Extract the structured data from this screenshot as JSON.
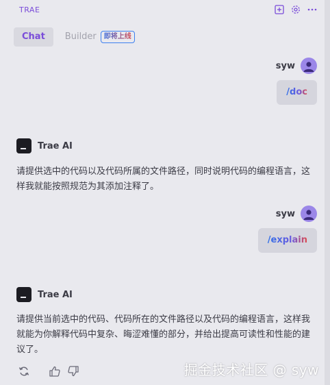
{
  "app": {
    "title": "TRAE"
  },
  "header_icons": [
    "add-square-icon",
    "gear-icon",
    "more-dots-icon"
  ],
  "tabs": [
    {
      "label": "Chat",
      "active": true
    },
    {
      "label": "Builder",
      "active": false,
      "badge": "即将上线"
    }
  ],
  "messages": [
    {
      "role": "user",
      "name": "syw",
      "text": "/doc"
    },
    {
      "role": "ai",
      "name": "Trae AI",
      "text": "请提供选中的代码以及代码所属的文件路径，同时说明代码的编程语言，这样我就能按照规范为其添加注释了。"
    },
    {
      "role": "user",
      "name": "syw",
      "text": "/explain"
    },
    {
      "role": "ai",
      "name": "Trae AI",
      "text": "请提供当前选中的代码、代码所在的文件路径以及代码的编程语言，这样我就能为你解释代码中复杂、晦涩难懂的部分，并给出提高可读性和性能的建议了。"
    }
  ],
  "message_actions": [
    "refresh-icon",
    "thumbs-up-icon",
    "thumbs-down-icon"
  ],
  "watermark": "掘金技术社区 @ syw",
  "colors": {
    "background": "#e9e9ee",
    "accent": "#7a4cd9",
    "bubble": "#d5d5dd",
    "avatar": "#9b87e8"
  }
}
